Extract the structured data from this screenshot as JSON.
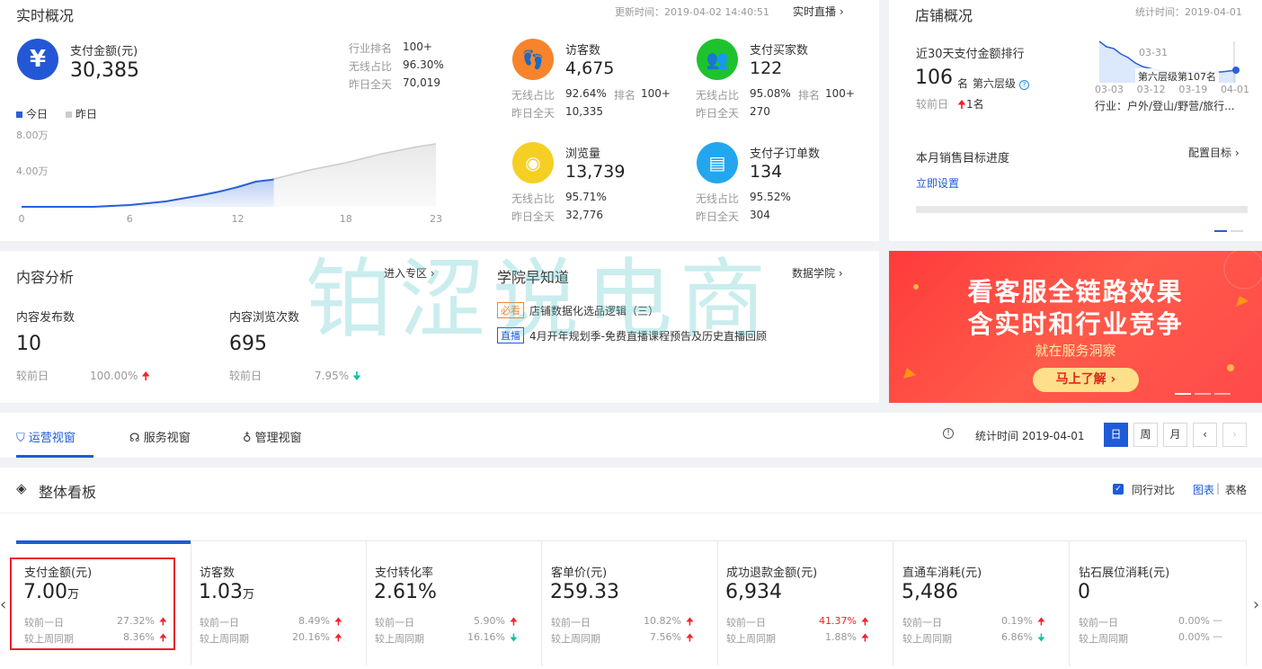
{
  "realtime": {
    "title": "实时概况",
    "update_time": "更新时间：2019-04-02 14:40:51",
    "live_link": "实时直播",
    "pay_amount_label": "支付金额(元)",
    "pay_amount_value": "30,385",
    "industry_rank_label": "行业排名",
    "industry_rank_value": "100+",
    "wireless_label": "无线占比",
    "wireless_value": "96.30%",
    "yesterday_label": "昨日全天",
    "yesterday_value": "70,019",
    "legend_today": "今日",
    "legend_yesterday": "昨日",
    "metrics": [
      {
        "icon": "footprint-icon",
        "color": "#f7842c",
        "label": "访客数",
        "value": "4,675",
        "wireless": "92.64%",
        "rank_label": "排名",
        "rank": "100+",
        "yesterday": "10,335"
      },
      {
        "icon": "buyers-icon",
        "color": "#1ec22e",
        "label": "支付买家数",
        "value": "122",
        "wireless": "95.08%",
        "rank_label": "排名",
        "rank": "100+",
        "yesterday": "270"
      },
      {
        "icon": "eye-icon",
        "color": "#f6cf24",
        "label": "浏览量",
        "value": "13,739",
        "wireless": "95.71%",
        "rank_label": "",
        "rank": "",
        "yesterday": "32,776"
      },
      {
        "icon": "order-icon",
        "color": "#22a7ef",
        "label": "支付子订单数",
        "value": "134",
        "wireless": "95.52%",
        "rank_label": "",
        "rank": "",
        "yesterday": "304"
      }
    ],
    "wireless_short": "无线占比",
    "yesterday_short": "昨日全天"
  },
  "chart_data": {
    "type": "area",
    "x_ticks": [
      "0",
      "6",
      "12",
      "18",
      "23"
    ],
    "y_ticks": [
      "8.00万",
      "4.00万"
    ],
    "ylim": [
      0,
      80000
    ],
    "series": [
      {
        "name": "今日",
        "color": "#2a5fd8",
        "x": [
          0,
          2,
          4,
          6,
          8,
          10,
          11,
          12,
          13,
          14
        ],
        "values": [
          0,
          0,
          0,
          2000,
          6000,
          13000,
          17000,
          22000,
          28000,
          30385
        ]
      },
      {
        "name": "昨日",
        "color": "#cccccc",
        "x": [
          0,
          2,
          4,
          6,
          8,
          10,
          12,
          14,
          16,
          18,
          20,
          22,
          23
        ],
        "values": [
          0,
          0,
          0,
          1500,
          5000,
          11000,
          19000,
          31000,
          41000,
          49000,
          59000,
          67000,
          70019
        ]
      }
    ]
  },
  "shop": {
    "title": "店铺概况",
    "stat_time": "统计时间：2019-04-01",
    "rank_title": "近30天支付金额排行",
    "rank_value": "106",
    "rank_unit": "名",
    "tier": "第六层级",
    "compare_label": "较前日",
    "compare_value": "1名",
    "spark_date": "03-31",
    "spark_tip": "第六层级第107名",
    "spark_x": [
      "03-03",
      "03-12",
      "03-19",
      "04-01"
    ],
    "industry": "行业：户外/登山/野营/旅行...",
    "target_title": "本月销售目标进度",
    "config_target": "配置目标",
    "set_now": "立即设置"
  },
  "content": {
    "title": "内容分析",
    "enter_link": "进入专区",
    "publish_label": "内容发布数",
    "publish_value": "10",
    "publish_compare_label": "较前日",
    "publish_compare": "100.00%",
    "browse_label": "内容浏览次数",
    "browse_value": "695",
    "browse_compare_label": "较前日",
    "browse_compare": "7.95%"
  },
  "academy": {
    "title": "学院早知道",
    "link": "数据学院",
    "items": [
      {
        "tag": "必看",
        "tag_color": "#f7842c",
        "text": "店铺数据化选品逻辑（三）"
      },
      {
        "tag": "直播",
        "tag_color": "#1f5bd8",
        "text": "4月开年规划季-免费直播课程预告及历史直播回顾"
      }
    ]
  },
  "banner": {
    "line1": "看客服全链路效果",
    "line2": "含实时和行业竞争",
    "line3": "就在服务洞察",
    "button": "马上了解"
  },
  "watermark": "铂涩说电商",
  "tabs": {
    "items": [
      "运营视窗",
      "服务视窗",
      "管理视窗"
    ],
    "stat_time": "统计时间 2019-04-01",
    "day": "日",
    "week": "周",
    "month": "月"
  },
  "board": {
    "title": "整体看板",
    "peer_compare": "同行对比",
    "chart_view": "图表",
    "table_view": "表格",
    "row1_label": "较前一日",
    "row2_label": "较上周同期",
    "metrics": [
      {
        "label": "支付金额(元)",
        "value": "7.00",
        "unit": "万",
        "d1": "27.32%",
        "d1_dir": "up",
        "d2": "8.36%",
        "d2_dir": "up"
      },
      {
        "label": "访客数",
        "value": "1.03",
        "unit": "万",
        "d1": "8.49%",
        "d1_dir": "up",
        "d2": "20.16%",
        "d2_dir": "up"
      },
      {
        "label": "支付转化率",
        "value": "2.61%",
        "unit": "",
        "d1": "5.90%",
        "d1_dir": "up",
        "d2": "16.16%",
        "d2_dir": "down"
      },
      {
        "label": "客单价(元)",
        "value": "259.33",
        "unit": "",
        "d1": "10.82%",
        "d1_dir": "up",
        "d2": "7.56%",
        "d2_dir": "up"
      },
      {
        "label": "成功退款金额(元)",
        "value": "6,934",
        "unit": "",
        "d1": "41.37%",
        "d1_dir": "up-red",
        "d2": "1.88%",
        "d2_dir": "up"
      },
      {
        "label": "直通车消耗(元)",
        "value": "5,486",
        "unit": "",
        "d1": "0.19%",
        "d1_dir": "up",
        "d2": "6.86%",
        "d2_dir": "down"
      },
      {
        "label": "钻石展位消耗(元)",
        "value": "0",
        "unit": "",
        "d1": "0.00%",
        "d1_dir": "flat",
        "d2": "0.00%",
        "d2_dir": "flat"
      }
    ]
  }
}
